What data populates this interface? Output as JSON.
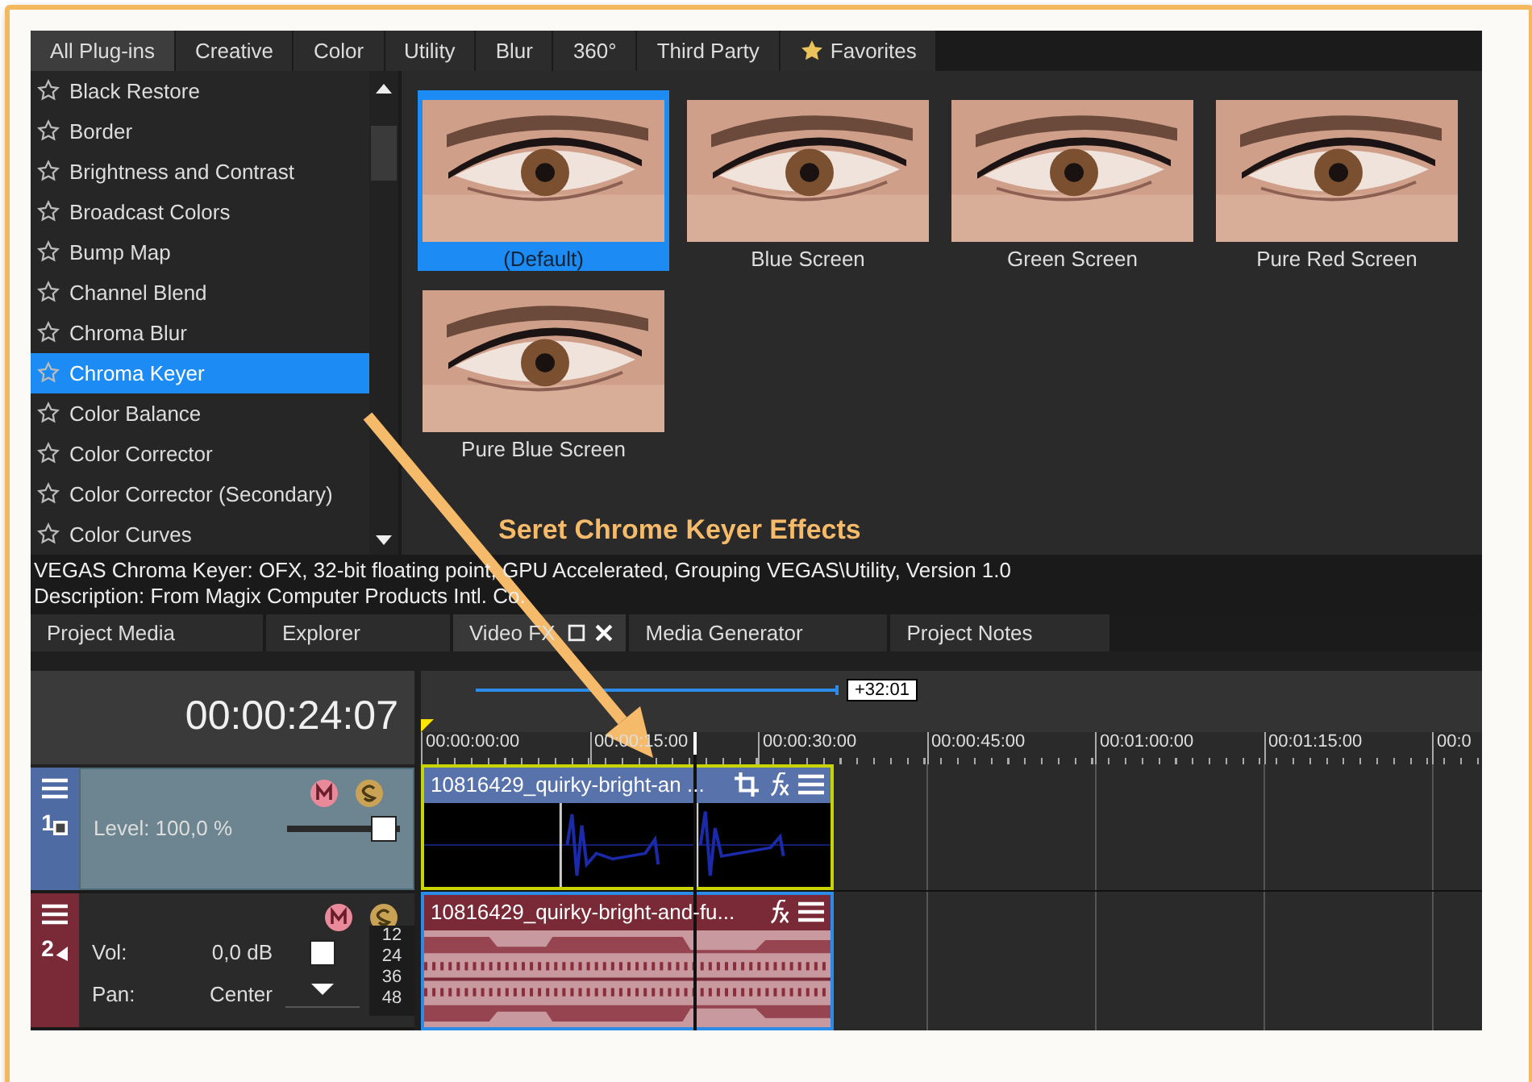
{
  "plugin_tabs": [
    {
      "label": "All Plug-ins",
      "selected": true
    },
    {
      "label": "Creative",
      "selected": false
    },
    {
      "label": "Color",
      "selected": false
    },
    {
      "label": "Utility",
      "selected": false
    },
    {
      "label": "Blur",
      "selected": false
    },
    {
      "label": "360°",
      "selected": false
    },
    {
      "label": "Third Party",
      "selected": false
    },
    {
      "label": "Favorites",
      "selected": false,
      "kind": "star"
    }
  ],
  "plugins": [
    {
      "name": "Black Restore",
      "selected": false
    },
    {
      "name": "Border",
      "selected": false
    },
    {
      "name": "Brightness and Contrast",
      "selected": false
    },
    {
      "name": "Broadcast Colors",
      "selected": false
    },
    {
      "name": "Bump Map",
      "selected": false
    },
    {
      "name": "Channel Blend",
      "selected": false
    },
    {
      "name": "Chroma Blur",
      "selected": false
    },
    {
      "name": "Chroma Keyer",
      "selected": true
    },
    {
      "name": "Color Balance",
      "selected": false
    },
    {
      "name": "Color Corrector",
      "selected": false
    },
    {
      "name": "Color Corrector (Secondary)",
      "selected": false
    },
    {
      "name": "Color Curves",
      "selected": false
    }
  ],
  "presets": [
    {
      "label": "(Default)",
      "selected": true
    },
    {
      "label": "Blue Screen",
      "selected": false
    },
    {
      "label": "Green Screen",
      "selected": false
    },
    {
      "label": "Pure Red Screen",
      "selected": false
    },
    {
      "label": "Pure Blue Screen",
      "selected": false
    }
  ],
  "annotation": {
    "text": "Seret Chrome Keyer Effects"
  },
  "info": {
    "line1": "VEGAS Chroma Keyer: OFX, 32-bit floating point, GPU Accelerated, Grouping VEGAS\\Utility, Version 1.0",
    "line2": "Description: From Magix Computer Products Intl. Co."
  },
  "dock_tabs": [
    {
      "label": "Project Media",
      "selected": false
    },
    {
      "label": "Explorer",
      "selected": false
    },
    {
      "label": "Video FX",
      "selected": true
    },
    {
      "label": "Media Generator",
      "selected": false
    },
    {
      "label": "Project Notes",
      "selected": false
    }
  ],
  "timeline": {
    "time": "00:00:24:07",
    "loop_length": "+32:01",
    "ruler": [
      "00:00:00:00",
      "00:00:15:00",
      "00:00:30:00",
      "00:00:45:00",
      "00:01:00:00",
      "00:01:15:00",
      "00:0"
    ],
    "tracks": [
      {
        "kind": "video",
        "number": "1",
        "level_label": "Level: 100,0 %",
        "level": 1,
        "clip": "10816429_quirky-bright-an ..."
      },
      {
        "kind": "audio",
        "number": "2",
        "vol_label": "Vol:",
        "vol": "0,0 dB",
        "level": 0.5,
        "pan_label": "Pan:",
        "pan": "Center",
        "pan_slider": {
          "level": 0.5
        },
        "meter": [
          "12",
          "24",
          "36",
          "48"
        ],
        "clip": "10816429_quirky-bright-and-fu..."
      }
    ]
  }
}
